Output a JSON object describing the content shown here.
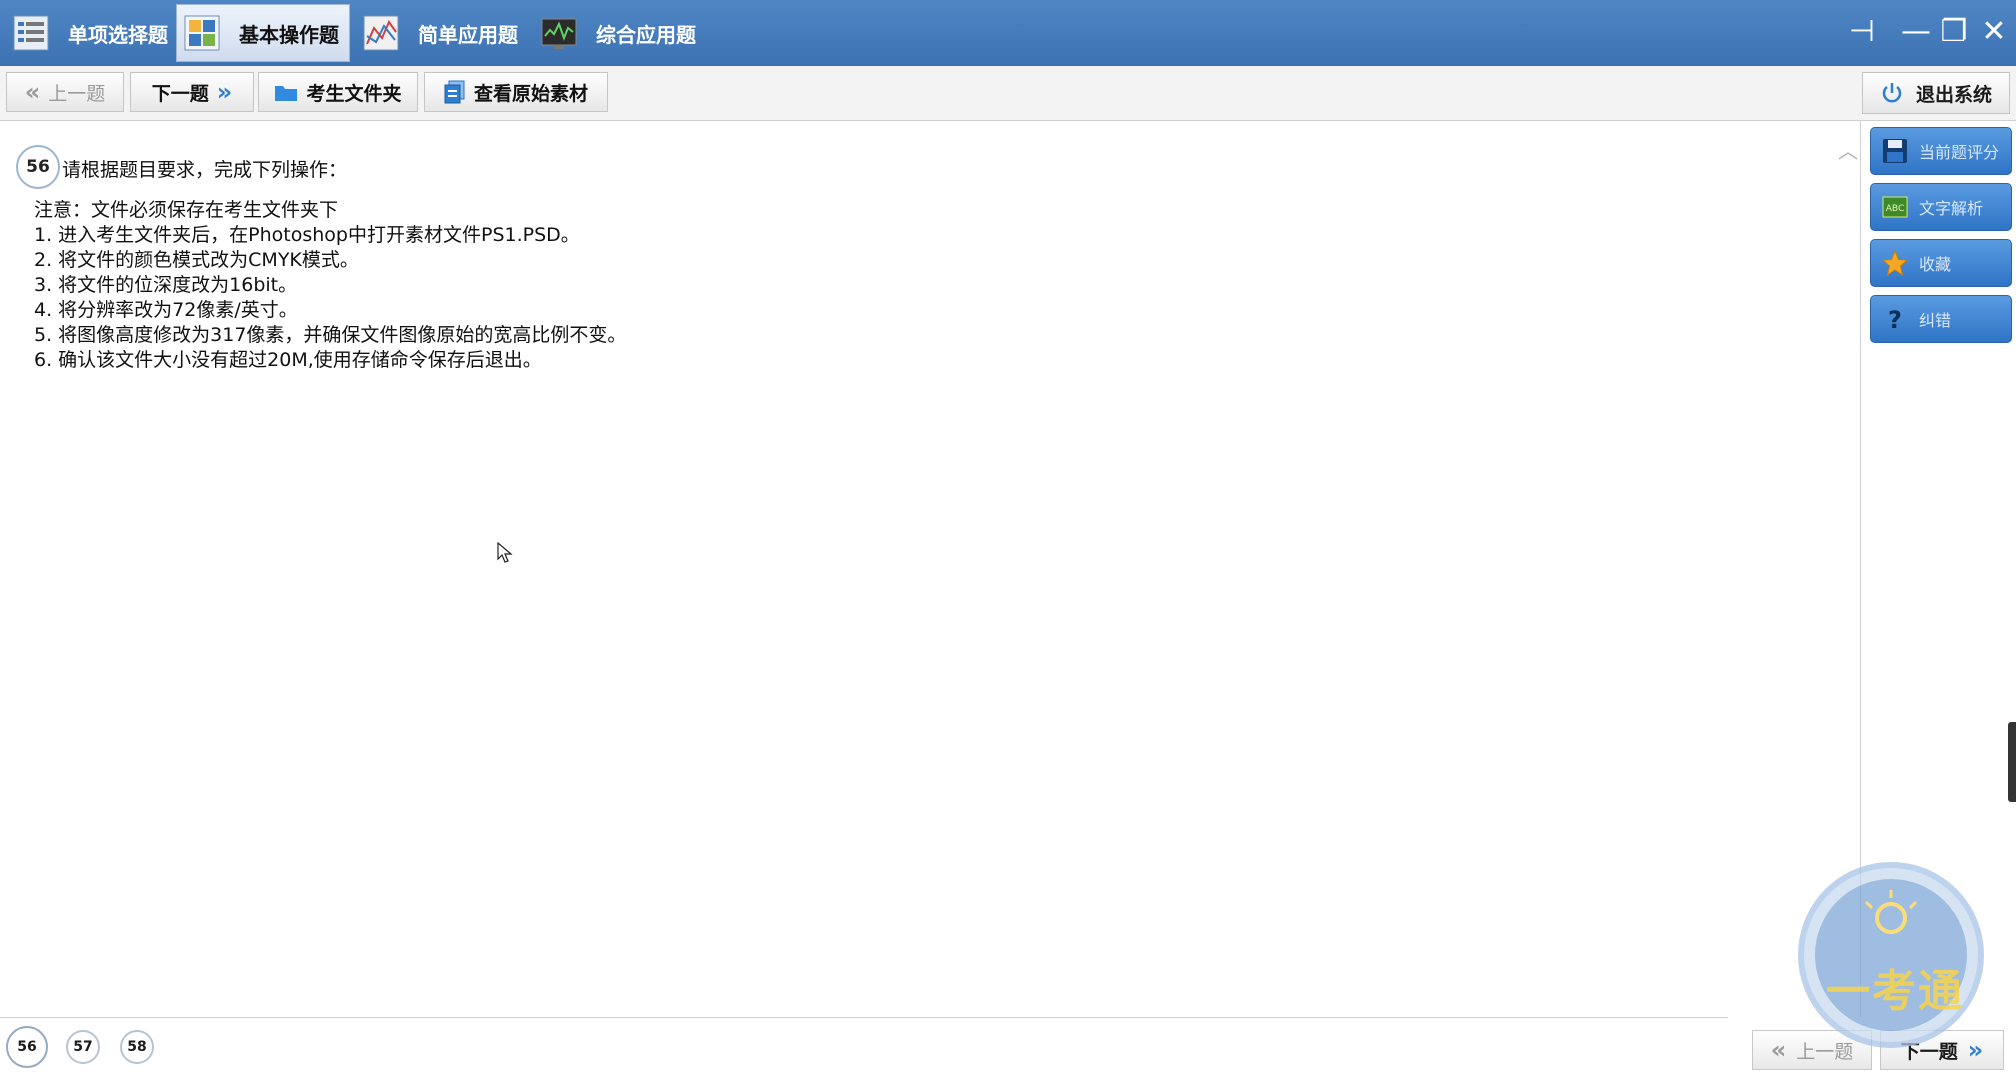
{
  "tabs": [
    {
      "label": "单项选择题",
      "icon": "list-icon",
      "active": false
    },
    {
      "label": "基本操作题",
      "icon": "grid-icon",
      "active": true
    },
    {
      "label": "简单应用题",
      "icon": "chart-icon",
      "active": false
    },
    {
      "label": "综合应用题",
      "icon": "monitor-icon",
      "active": false
    }
  ],
  "window_controls": {
    "pin": "⊣",
    "minimize": "—",
    "restore": "❐",
    "close": "✕"
  },
  "toolbar": {
    "prev_label": "上一题",
    "next_label": "下一题",
    "folder_label": "考生文件夹",
    "material_label": "查看原始素材",
    "exit_label": "退出系统"
  },
  "question": {
    "number": "56",
    "title": "请根据题目要求，完成下列操作：",
    "lines": [
      "注意：文件必须保存在考生文件夹下",
      "1. 进入考生文件夹后，在Photoshop中打开素材文件PS1.PSD。",
      "2. 将文件的颜色模式改为CMYK模式。",
      "3. 将文件的位深度改为16bit。",
      "4. 将分辨率改为72像素/英寸。",
      "5. 将图像高度修改为317像素，并确保文件图像原始的宽高比例不变。",
      "6. 确认该文件大小没有超过20M,使用存储命令保存后退出。"
    ]
  },
  "side_buttons": [
    {
      "label": "当前题评分",
      "icon": "save-icon"
    },
    {
      "label": "文字解析",
      "icon": "text-analysis-icon"
    },
    {
      "label": "收藏",
      "icon": "star-icon"
    },
    {
      "label": "纠错",
      "icon": "question-icon"
    }
  ],
  "pager": {
    "pages": [
      "56",
      "57",
      "58"
    ],
    "current": "56",
    "prev_label": "上一题",
    "next_label": "下一题"
  },
  "watermark_text": "一考通",
  "colors": {
    "titlebar": "#3c72b2",
    "side_button": "#2f74c6",
    "accent_chevron": "#2f7fd0"
  }
}
